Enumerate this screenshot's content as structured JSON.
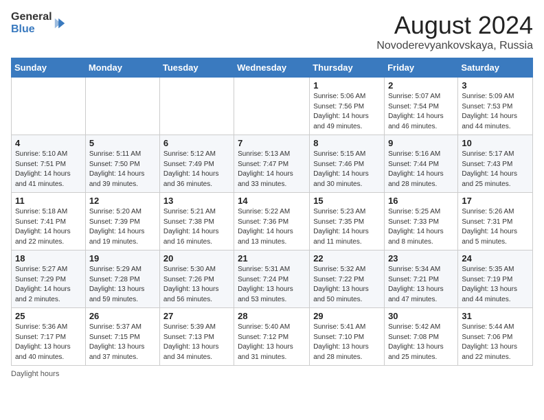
{
  "logo": {
    "general": "General",
    "blue": "Blue"
  },
  "title": "August 2024",
  "subtitle": "Novoderevyankovskaya, Russia",
  "days": [
    "Sunday",
    "Monday",
    "Tuesday",
    "Wednesday",
    "Thursday",
    "Friday",
    "Saturday"
  ],
  "footer_text": "Daylight hours",
  "weeks": [
    [
      {
        "day": "",
        "info": ""
      },
      {
        "day": "",
        "info": ""
      },
      {
        "day": "",
        "info": ""
      },
      {
        "day": "",
        "info": ""
      },
      {
        "day": "1",
        "info": "Sunrise: 5:06 AM\nSunset: 7:56 PM\nDaylight: 14 hours\nand 49 minutes."
      },
      {
        "day": "2",
        "info": "Sunrise: 5:07 AM\nSunset: 7:54 PM\nDaylight: 14 hours\nand 46 minutes."
      },
      {
        "day": "3",
        "info": "Sunrise: 5:09 AM\nSunset: 7:53 PM\nDaylight: 14 hours\nand 44 minutes."
      }
    ],
    [
      {
        "day": "4",
        "info": "Sunrise: 5:10 AM\nSunset: 7:51 PM\nDaylight: 14 hours\nand 41 minutes."
      },
      {
        "day": "5",
        "info": "Sunrise: 5:11 AM\nSunset: 7:50 PM\nDaylight: 14 hours\nand 39 minutes."
      },
      {
        "day": "6",
        "info": "Sunrise: 5:12 AM\nSunset: 7:49 PM\nDaylight: 14 hours\nand 36 minutes."
      },
      {
        "day": "7",
        "info": "Sunrise: 5:13 AM\nSunset: 7:47 PM\nDaylight: 14 hours\nand 33 minutes."
      },
      {
        "day": "8",
        "info": "Sunrise: 5:15 AM\nSunset: 7:46 PM\nDaylight: 14 hours\nand 30 minutes."
      },
      {
        "day": "9",
        "info": "Sunrise: 5:16 AM\nSunset: 7:44 PM\nDaylight: 14 hours\nand 28 minutes."
      },
      {
        "day": "10",
        "info": "Sunrise: 5:17 AM\nSunset: 7:43 PM\nDaylight: 14 hours\nand 25 minutes."
      }
    ],
    [
      {
        "day": "11",
        "info": "Sunrise: 5:18 AM\nSunset: 7:41 PM\nDaylight: 14 hours\nand 22 minutes."
      },
      {
        "day": "12",
        "info": "Sunrise: 5:20 AM\nSunset: 7:39 PM\nDaylight: 14 hours\nand 19 minutes."
      },
      {
        "day": "13",
        "info": "Sunrise: 5:21 AM\nSunset: 7:38 PM\nDaylight: 14 hours\nand 16 minutes."
      },
      {
        "day": "14",
        "info": "Sunrise: 5:22 AM\nSunset: 7:36 PM\nDaylight: 14 hours\nand 13 minutes."
      },
      {
        "day": "15",
        "info": "Sunrise: 5:23 AM\nSunset: 7:35 PM\nDaylight: 14 hours\nand 11 minutes."
      },
      {
        "day": "16",
        "info": "Sunrise: 5:25 AM\nSunset: 7:33 PM\nDaylight: 14 hours\nand 8 minutes."
      },
      {
        "day": "17",
        "info": "Sunrise: 5:26 AM\nSunset: 7:31 PM\nDaylight: 14 hours\nand 5 minutes."
      }
    ],
    [
      {
        "day": "18",
        "info": "Sunrise: 5:27 AM\nSunset: 7:29 PM\nDaylight: 14 hours\nand 2 minutes."
      },
      {
        "day": "19",
        "info": "Sunrise: 5:29 AM\nSunset: 7:28 PM\nDaylight: 13 hours\nand 59 minutes."
      },
      {
        "day": "20",
        "info": "Sunrise: 5:30 AM\nSunset: 7:26 PM\nDaylight: 13 hours\nand 56 minutes."
      },
      {
        "day": "21",
        "info": "Sunrise: 5:31 AM\nSunset: 7:24 PM\nDaylight: 13 hours\nand 53 minutes."
      },
      {
        "day": "22",
        "info": "Sunrise: 5:32 AM\nSunset: 7:22 PM\nDaylight: 13 hours\nand 50 minutes."
      },
      {
        "day": "23",
        "info": "Sunrise: 5:34 AM\nSunset: 7:21 PM\nDaylight: 13 hours\nand 47 minutes."
      },
      {
        "day": "24",
        "info": "Sunrise: 5:35 AM\nSunset: 7:19 PM\nDaylight: 13 hours\nand 44 minutes."
      }
    ],
    [
      {
        "day": "25",
        "info": "Sunrise: 5:36 AM\nSunset: 7:17 PM\nDaylight: 13 hours\nand 40 minutes."
      },
      {
        "day": "26",
        "info": "Sunrise: 5:37 AM\nSunset: 7:15 PM\nDaylight: 13 hours\nand 37 minutes."
      },
      {
        "day": "27",
        "info": "Sunrise: 5:39 AM\nSunset: 7:13 PM\nDaylight: 13 hours\nand 34 minutes."
      },
      {
        "day": "28",
        "info": "Sunrise: 5:40 AM\nSunset: 7:12 PM\nDaylight: 13 hours\nand 31 minutes."
      },
      {
        "day": "29",
        "info": "Sunrise: 5:41 AM\nSunset: 7:10 PM\nDaylight: 13 hours\nand 28 minutes."
      },
      {
        "day": "30",
        "info": "Sunrise: 5:42 AM\nSunset: 7:08 PM\nDaylight: 13 hours\nand 25 minutes."
      },
      {
        "day": "31",
        "info": "Sunrise: 5:44 AM\nSunset: 7:06 PM\nDaylight: 13 hours\nand 22 minutes."
      }
    ]
  ]
}
